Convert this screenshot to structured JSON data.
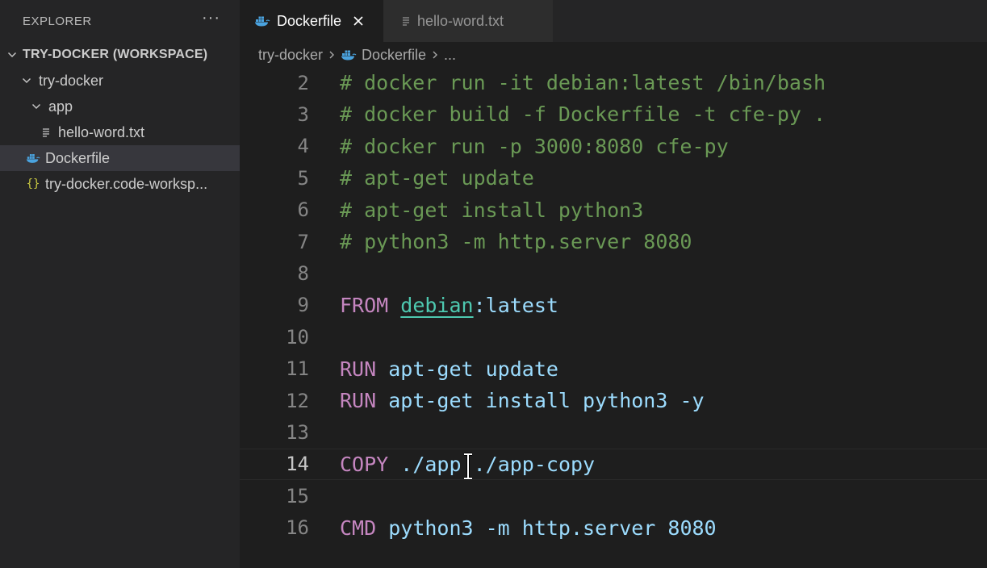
{
  "sidebar": {
    "title": "EXPLORER",
    "more_label": "···",
    "workspace": "TRY-DOCKER (WORKSPACE)",
    "items": [
      {
        "label": "try-docker"
      },
      {
        "label": "app"
      },
      {
        "label": "hello-word.txt"
      },
      {
        "label": "Dockerfile"
      },
      {
        "label": "try-docker.code-worksp..."
      }
    ]
  },
  "tabs": [
    {
      "label": "Dockerfile"
    },
    {
      "label": "hello-word.txt"
    }
  ],
  "breadcrumb": {
    "folder": "try-docker",
    "file": "Dockerfile",
    "more": "..."
  },
  "editor": {
    "current_line": 14,
    "lines": [
      {
        "n": "2",
        "text": "# docker run -it debian:latest /bin/bash"
      },
      {
        "n": "3",
        "text": "# docker build -f Dockerfile -t cfe-py ."
      },
      {
        "n": "4",
        "text": "# docker run -p 3000:8080 cfe-py"
      },
      {
        "n": "5",
        "text": "# apt-get update"
      },
      {
        "n": "6",
        "text": "# apt-get install python3"
      },
      {
        "n": "7",
        "text": "# python3 -m http.server 8080"
      },
      {
        "n": "8",
        "text": ""
      },
      {
        "n": "9",
        "kw": "FROM",
        "image": "debian",
        "rest": ":latest"
      },
      {
        "n": "10",
        "text": ""
      },
      {
        "n": "11",
        "kw": "RUN",
        "rest": "apt-get update"
      },
      {
        "n": "12",
        "kw": "RUN",
        "rest": "apt-get install python3 -y"
      },
      {
        "n": "13",
        "text": ""
      },
      {
        "n": "14",
        "kw": "COPY",
        "rest": "./app ./app-copy"
      },
      {
        "n": "15",
        "text": ""
      },
      {
        "n": "16",
        "kw": "CMD",
        "rest": "python3 -m http.server 8080"
      }
    ]
  },
  "colors": {
    "comment": "#6a9955",
    "keyword": "#c586c0",
    "text": "#9cdcfe",
    "image": "#4ec9b0",
    "docker_blue": "#0db7ed"
  }
}
